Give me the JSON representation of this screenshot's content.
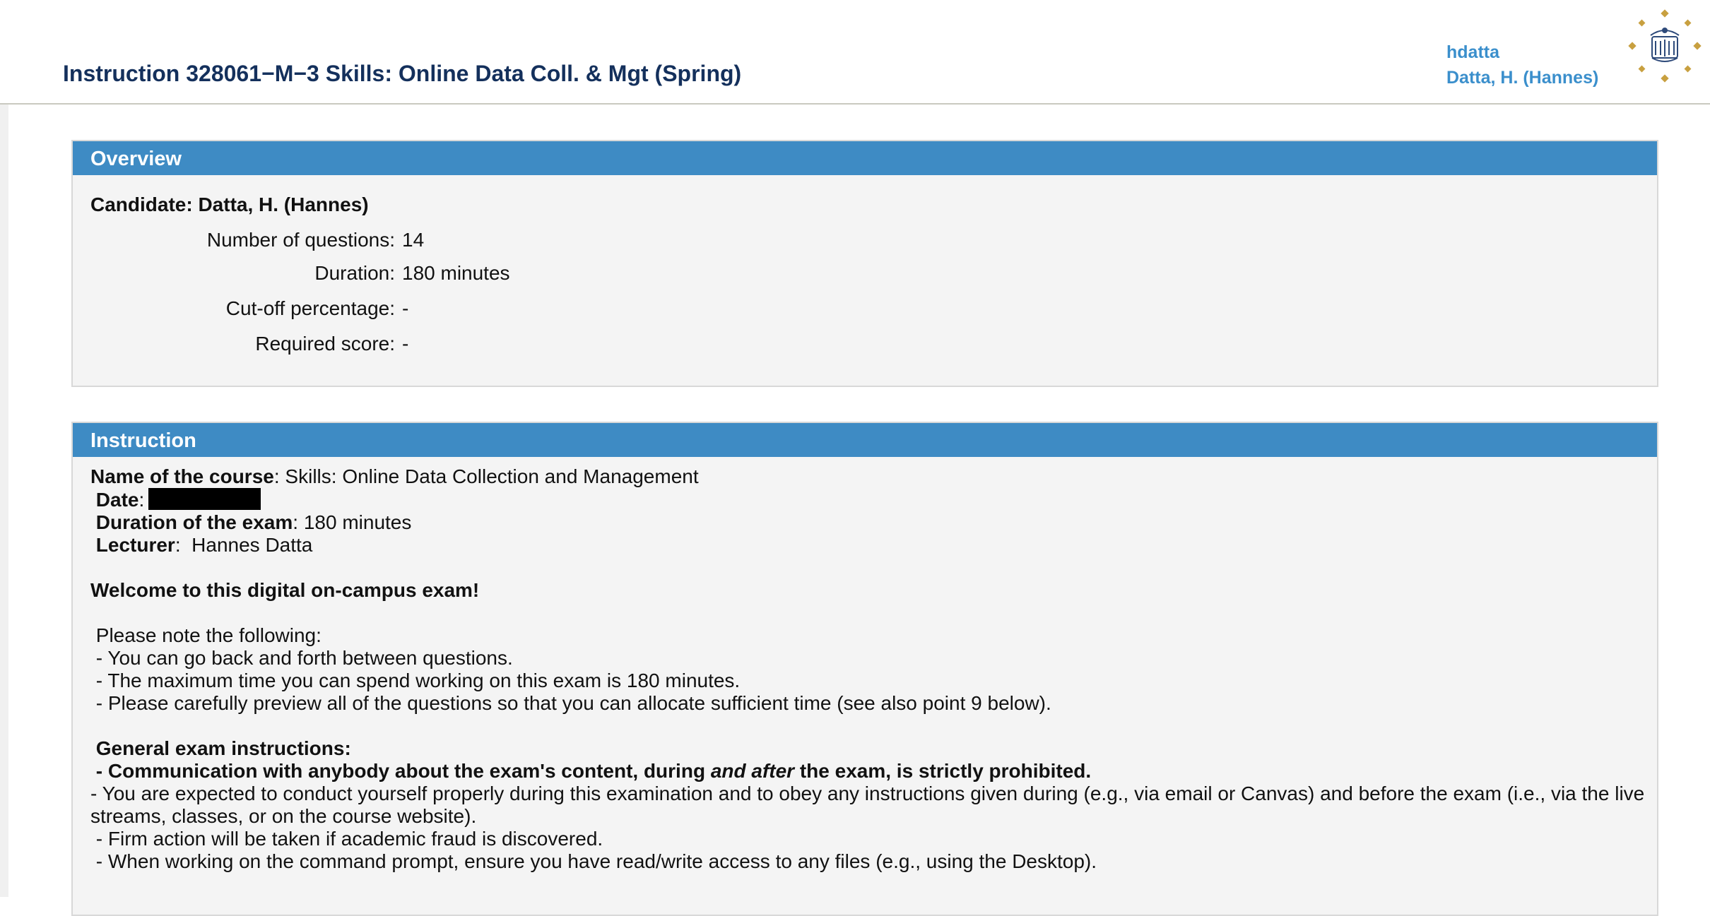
{
  "header": {
    "title": "Instruction 328061−M−3 Skills: Online Data Coll. & Mgt (Spring)",
    "username": "hdatta",
    "full_name": "Datta, H. (Hannes)"
  },
  "overview": {
    "heading": "Overview",
    "candidate": "Candidate: Datta, H. (Hannes)",
    "rows": [
      {
        "label": "Number of questions:",
        "value": "14"
      },
      {
        "label": "Duration:",
        "value": "180 minutes"
      },
      {
        "label": "Cut-off percentage:",
        "value": "-"
      },
      {
        "label": "Required score:",
        "value": "-"
      }
    ]
  },
  "instruction": {
    "heading": "Instruction",
    "course_label": "Name of the course",
    "course_value": ": Skills: Online Data Collection and Management",
    "date_label": " Date",
    "date_sep": ":",
    "duration_label": " Duration of the exam",
    "duration_value": ": 180 minutes",
    "lecturer_label": " Lecturer",
    "lecturer_value": ":  Hannes Datta",
    "welcome": "Welcome to this digital on-campus exam!",
    "note_intro": " Please note the following:",
    "notes": [
      " - You can go back and forth between questions.",
      " - The maximum time you can spend working on this exam is 180 minutes.",
      " - Please carefully preview all of the questions so that you can allocate sufficient time (see also point 9 below)."
    ],
    "general_heading": " General exam instructions:",
    "rule1_dash": " - ",
    "rule1_part1": "Communication with anybody about the exam's content, during ",
    "rule1_italic": "and after",
    "rule1_part2": " the exam, is strictly prohibited.",
    "rules": [
      " - You are expected to conduct yourself properly during this examination and to obey any instructions given during (e.g., via email or Canvas) and before the exam (i.e., via the live streams, classes, or on the course website).",
      " - Firm action will be taken if academic fraud is discovered.",
      " - When working on the command prompt, ensure you have read/write access to any files (e.g., using the Desktop)."
    ]
  },
  "colors": {
    "panel_header": "#3e8bc4",
    "title": "#14305c",
    "user_link": "#3b8fcc",
    "logo_gold": "#c8a040",
    "logo_navy": "#2e4a7a"
  },
  "icons": {
    "logo": "university-seal-icon"
  }
}
